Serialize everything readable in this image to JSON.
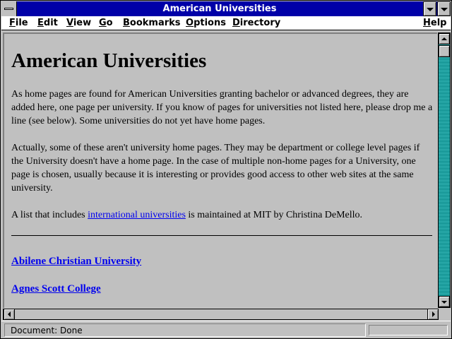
{
  "window": {
    "title": "American Universities"
  },
  "menubar": {
    "items": [
      {
        "first": "F",
        "rest": "ile"
      },
      {
        "first": "E",
        "rest": "dit"
      },
      {
        "first": "V",
        "rest": "iew"
      },
      {
        "first": "G",
        "rest": "o"
      },
      {
        "first": "B",
        "rest": "ookmarks"
      },
      {
        "first": "O",
        "rest": "ptions"
      },
      {
        "first": "D",
        "rest": "irectory"
      },
      {
        "first": "H",
        "rest": "elp"
      }
    ]
  },
  "page": {
    "heading": "American Universities",
    "para1": "As home pages are found for American Universities granting bachelor or advanced degrees, they are added here, one page per university. If you know of pages for universities not listed here, please drop me a line (see below). Some universities do not yet have home pages.",
    "para2": "Actually, some of these aren't university home pages. They may be department or college level pages if the University doesn't have a home page. In the case of multiple non-home pages for a University, one page is chosen, usually because it is interesting or provides good access to other web sites at the same university.",
    "para3_before": "A list that includes ",
    "para3_link": "international universities",
    "para3_after": " is maintained at MIT by Christina DeMello.",
    "universities": [
      "Abilene Christian University",
      "Agnes Scott College"
    ]
  },
  "statusbar": {
    "text": "Document: Done"
  },
  "colors": {
    "titlebar": "#0000a8",
    "chrome": "#c0c0c0",
    "link": "#0000ee",
    "scroll_track": "#00a8a8"
  }
}
